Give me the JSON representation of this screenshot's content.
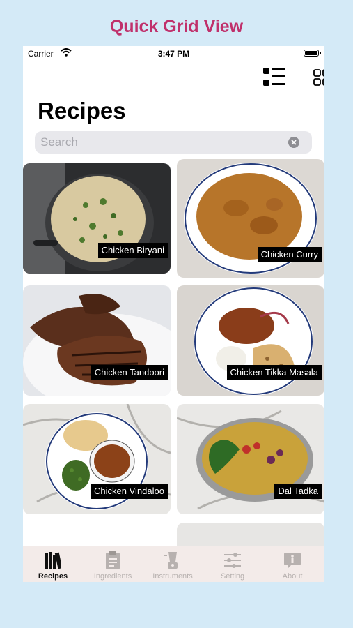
{
  "banner": "Quick Grid View",
  "status_bar": {
    "carrier": "Carrier",
    "time": "3:47 PM"
  },
  "title": "Recipes",
  "search": {
    "placeholder": "Search",
    "value": ""
  },
  "recipes": [
    {
      "name": "Chicken Biryani"
    },
    {
      "name": "Chicken Curry"
    },
    {
      "name": "Chicken Tandoori"
    },
    {
      "name": "Chicken Tikka Masala"
    },
    {
      "name": "Chicken Vindaloo"
    },
    {
      "name": "Dal Tadka"
    }
  ],
  "tabs": [
    {
      "label": "Recipes",
      "icon": "books-icon",
      "active": true
    },
    {
      "label": "Ingredients",
      "icon": "clipboard-icon",
      "active": false
    },
    {
      "label": "Instruments",
      "icon": "blender-icon",
      "active": false
    },
    {
      "label": "Setting",
      "icon": "sliders-icon",
      "active": false
    },
    {
      "label": "About",
      "icon": "info-bubble-icon",
      "active": false
    }
  ],
  "colors": {
    "banner": "#c0306b",
    "background": "#d4eaf7",
    "tab_bar": "#f3ebe9"
  }
}
